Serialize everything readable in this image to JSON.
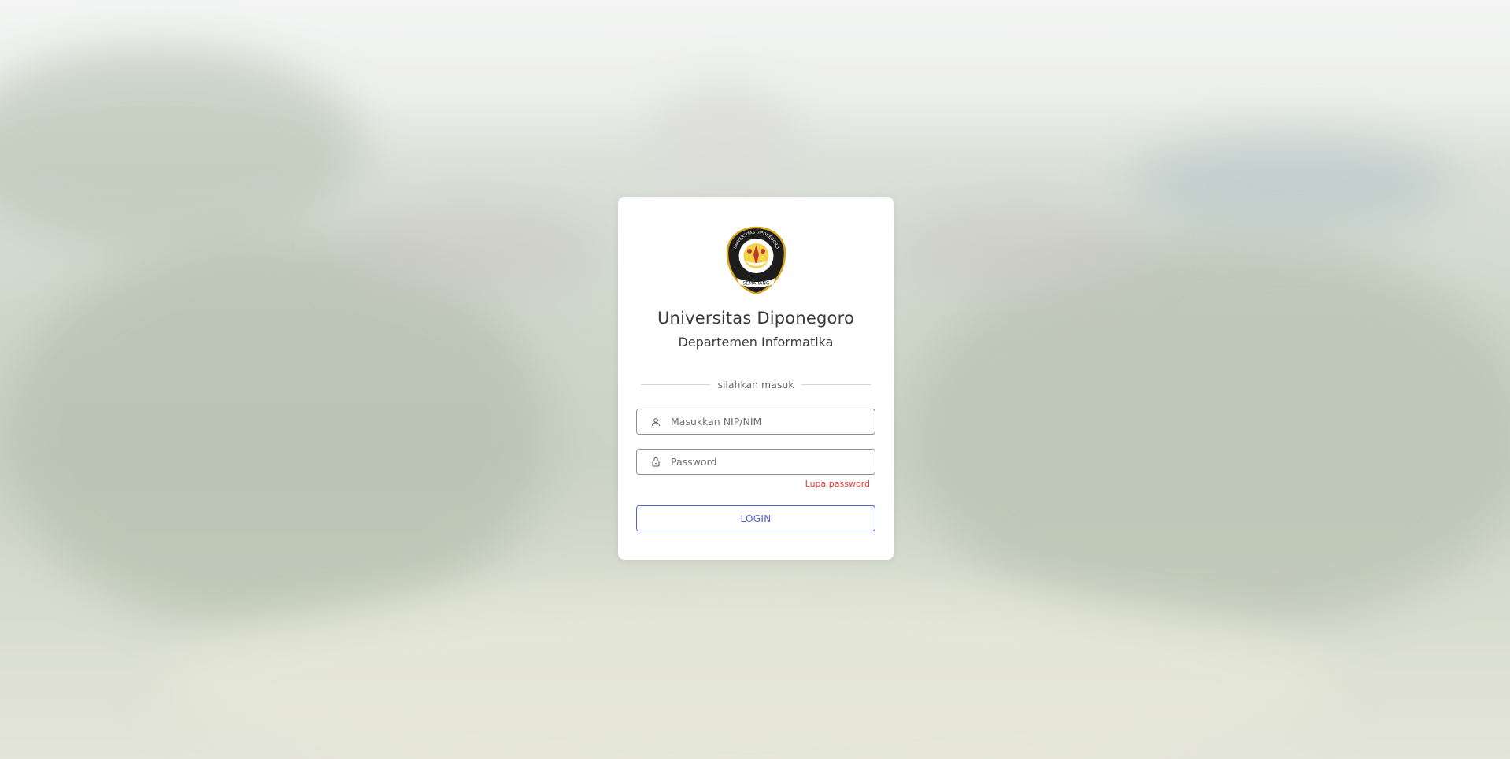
{
  "background": {
    "description_color": "#c3ccbd"
  },
  "card": {
    "logo_icon": "university-seal-icon",
    "logo_text_top": "UNIVERSITAS DIPONEGORO",
    "logo_text_bottom": "SEMARANG",
    "title": "Universitas Diponegoro",
    "subtitle": "Departemen Informatika",
    "divider_text": "silahkan masuk"
  },
  "form": {
    "username": {
      "icon": "user-icon",
      "placeholder": "Masukkan NIP/NIM",
      "value": ""
    },
    "password": {
      "icon": "lock-icon",
      "placeholder": "Password",
      "value": ""
    },
    "forgot_label": "Lupa password",
    "login_label": "LOGIN"
  },
  "colors": {
    "accent": "#4a63d8",
    "danger": "#e53935",
    "text": "#3a3a3a"
  }
}
